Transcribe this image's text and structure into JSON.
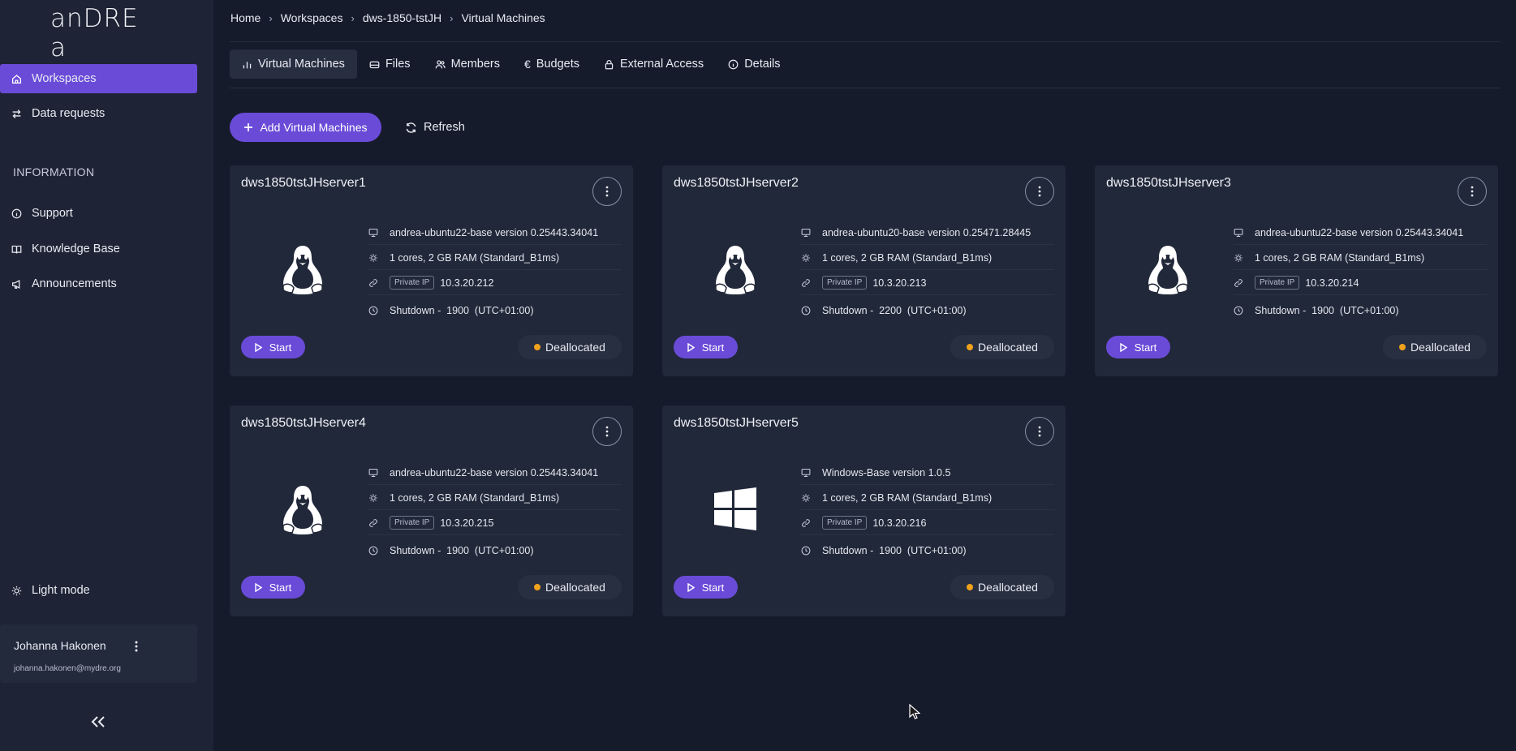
{
  "app": {
    "logo_text": "anDRE a"
  },
  "colors": {
    "accent": "#6a4bd8",
    "status_deallocated": "#f0a21c",
    "background": "#161b2c",
    "sidebar": "#1e2435",
    "card": "#212839"
  },
  "sidebar": {
    "items": [
      {
        "label": "Workspaces",
        "icon": "home-icon",
        "active": true
      },
      {
        "label": "Data requests",
        "icon": "arrows-exchange-icon",
        "active": false
      }
    ],
    "section_label": "INFORMATION",
    "info_items": [
      {
        "label": "Support",
        "icon": "info-icon"
      },
      {
        "label": "Knowledge Base",
        "icon": "book-icon"
      },
      {
        "label": "Announcements",
        "icon": "megaphone-icon"
      }
    ],
    "theme_toggle": "Light mode",
    "user": {
      "name": "Johanna Hakonen",
      "email": "johanna.hakonen@mydre.org"
    },
    "collapse_icon": "double-chevron-left-icon"
  },
  "breadcrumb": [
    "Home",
    "Workspaces",
    "dws-1850-tstJH",
    "Virtual Machines"
  ],
  "tabs": [
    {
      "label": "Virtual Machines",
      "icon": "bar-chart-icon",
      "active": true
    },
    {
      "label": "Files",
      "icon": "drive-icon",
      "active": false
    },
    {
      "label": "Members",
      "icon": "users-icon",
      "active": false
    },
    {
      "label": "Budgets",
      "icon": "euro-icon",
      "active": false
    },
    {
      "label": "External Access",
      "icon": "lock-icon",
      "active": false
    },
    {
      "label": "Details",
      "icon": "info-icon",
      "active": false
    }
  ],
  "actions": {
    "add_label": "Add Virtual Machines",
    "refresh_label": "Refresh"
  },
  "vms": [
    {
      "name": "dws1850tstJHserver1",
      "os": "linux",
      "image": "andrea-ubuntu22-base version 0.25443.34041",
      "size": "1 cores, 2 GB RAM (Standard_B1ms)",
      "ip_label": "Private IP",
      "ip": "10.3.20.212",
      "shutdown": "Shutdown -  1900  (UTC+01:00)",
      "start_label": "Start",
      "status": "Deallocated"
    },
    {
      "name": "dws1850tstJHserver2",
      "os": "linux",
      "image": "andrea-ubuntu20-base version 0.25471.28445",
      "size": "1 cores, 2 GB RAM (Standard_B1ms)",
      "ip_label": "Private IP",
      "ip": "10.3.20.213",
      "shutdown": "Shutdown -  2200  (UTC+01:00)",
      "start_label": "Start",
      "status": "Deallocated"
    },
    {
      "name": "dws1850tstJHserver3",
      "os": "linux",
      "image": "andrea-ubuntu22-base version 0.25443.34041",
      "size": "1 cores, 2 GB RAM (Standard_B1ms)",
      "ip_label": "Private IP",
      "ip": "10.3.20.214",
      "shutdown": "Shutdown -  1900  (UTC+01:00)",
      "start_label": "Start",
      "status": "Deallocated"
    },
    {
      "name": "dws1850tstJHserver4",
      "os": "linux",
      "image": "andrea-ubuntu22-base version 0.25443.34041",
      "size": "1 cores, 2 GB RAM (Standard_B1ms)",
      "ip_label": "Private IP",
      "ip": "10.3.20.215",
      "shutdown": "Shutdown -  1900  (UTC+01:00)",
      "start_label": "Start",
      "status": "Deallocated"
    },
    {
      "name": "dws1850tstJHserver5",
      "os": "windows",
      "image": "Windows-Base version 1.0.5",
      "size": "1 cores, 2 GB RAM (Standard_B1ms)",
      "ip_label": "Private IP",
      "ip": "10.3.20.216",
      "shutdown": "Shutdown -  1900  (UTC+01:00)",
      "start_label": "Start",
      "status": "Deallocated"
    }
  ]
}
